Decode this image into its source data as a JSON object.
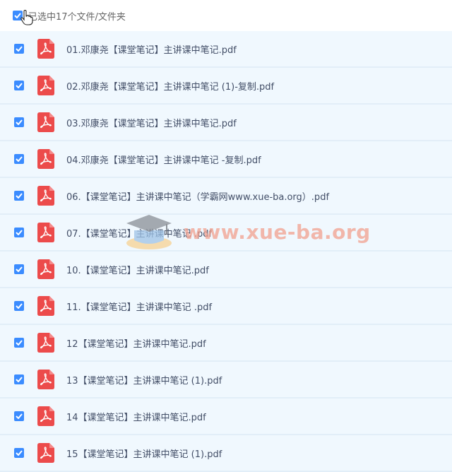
{
  "header": {
    "label": "已选中17个文件/文件夹",
    "checked": true
  },
  "files": [
    {
      "name": "01.邓康尧【课堂笔记】主讲课中笔记.pdf"
    },
    {
      "name": "02.邓康尧【课堂笔记】主讲课中笔记 (1)-复制.pdf"
    },
    {
      "name": "03.邓康尧【课堂笔记】主讲课中笔记.pdf"
    },
    {
      "name": "04.邓康尧【课堂笔记】主讲课中笔记 -复制.pdf"
    },
    {
      "name": "06.【课堂笔记】主讲课中笔记（学霸网www.xue-ba.org）.pdf"
    },
    {
      "name": "07.【课堂笔记】主讲课中笔记 .pdf"
    },
    {
      "name": "10.【课堂笔记】主讲课中笔记.pdf"
    },
    {
      "name": "11.【课堂笔记】主讲课中笔记 .pdf"
    },
    {
      "name": "12【课堂笔记】主讲课中笔记.pdf"
    },
    {
      "name": "13【课堂笔记】主讲课中笔记 (1).pdf"
    },
    {
      "name": "14【课堂笔记】主讲课中笔记.pdf"
    },
    {
      "name": "15【课堂笔记】主讲课中笔记 (1).pdf"
    }
  ],
  "watermark": {
    "text": "www.xue-ba.org"
  },
  "colors": {
    "checkbox": "#3b8cff",
    "pdf_icon": "#ec4b4b",
    "row_bg": "#f0f8fe"
  }
}
